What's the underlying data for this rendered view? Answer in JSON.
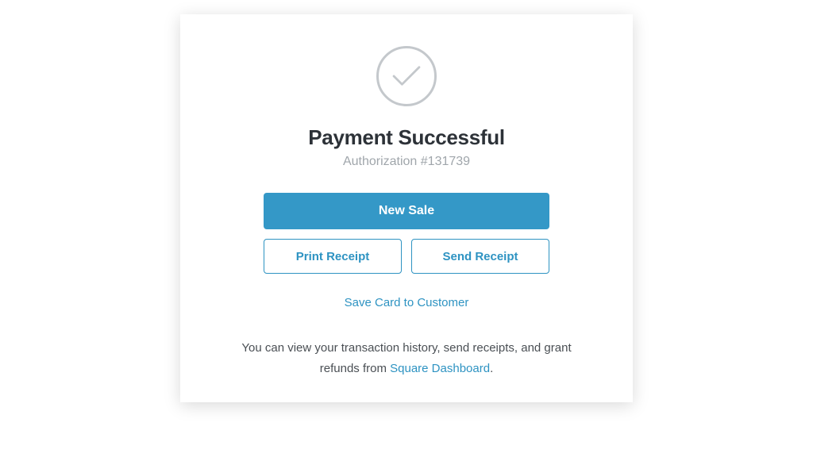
{
  "header": {
    "title": "Payment Successful",
    "authorization_label": "Authorization #131739"
  },
  "actions": {
    "new_sale": "New Sale",
    "print_receipt": "Print Receipt",
    "send_receipt": "Send Receipt",
    "save_card": "Save Card to Customer"
  },
  "footer": {
    "text_before": "You can view your transaction history, send receipts, and grant refunds from ",
    "link_text": "Square Dashboard",
    "text_after": "."
  },
  "colors": {
    "primary": "#3498c7",
    "link": "#2e93c2",
    "text_dark": "#2d3238",
    "text_muted": "#a0a6ab",
    "icon_stroke": "#c4c8cc"
  }
}
